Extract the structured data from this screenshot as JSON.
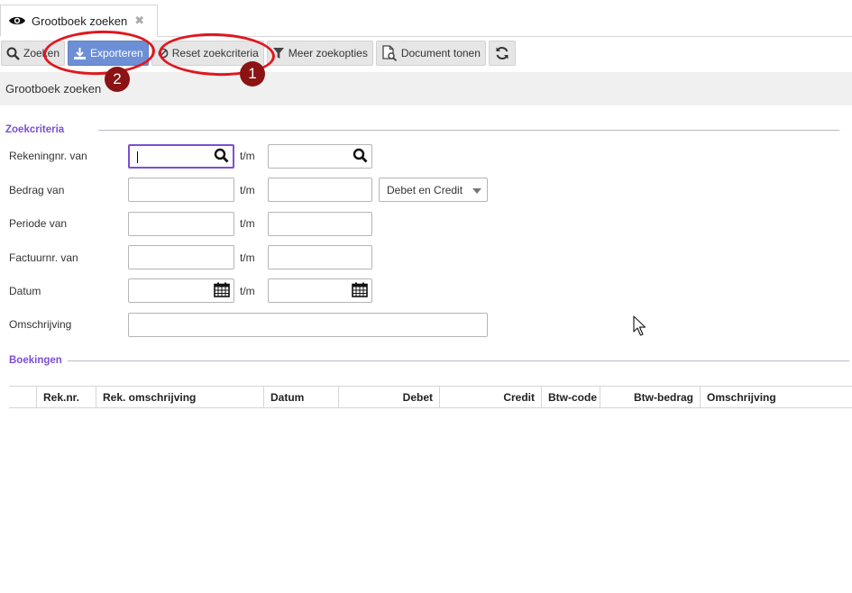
{
  "tab": {
    "title": "Grootboek zoeken",
    "icon": "eye-icon",
    "close_icon": "close-icon"
  },
  "toolbar": {
    "search_label": "Zoeken",
    "export_label": "Exporteren",
    "reset_label": "Reset zoekcriteria",
    "more_label": "Meer zoekopties",
    "document_label": "Document tonen",
    "refresh_icon": "refresh-icon"
  },
  "breadcrumb": "Grootboek zoeken",
  "criteria": {
    "title": "Zoekcriteria",
    "account_label": "Rekeningnr. van",
    "amount_label": "Bedrag van",
    "period_label": "Periode van",
    "invoice_label": "Factuurnr. van",
    "date_label": "Datum",
    "description_label": "Omschrijving",
    "tm": "t/m",
    "debit_credit_value": "Debet en Credit"
  },
  "bookings": {
    "title": "Boekingen",
    "columns": [
      "Rek.nr.",
      "Rek. omschrijving",
      "Datum",
      "Debet",
      "Credit",
      "Btw-code",
      "Btw-bedrag",
      "Omschrijving"
    ]
  },
  "annotations": {
    "one": "1",
    "two": "2"
  },
  "colors": {
    "accent": "#7b4fd4",
    "primary_button": "#6d8fd6",
    "annotation_red": "#e0171e",
    "badge": "#8b1313"
  }
}
